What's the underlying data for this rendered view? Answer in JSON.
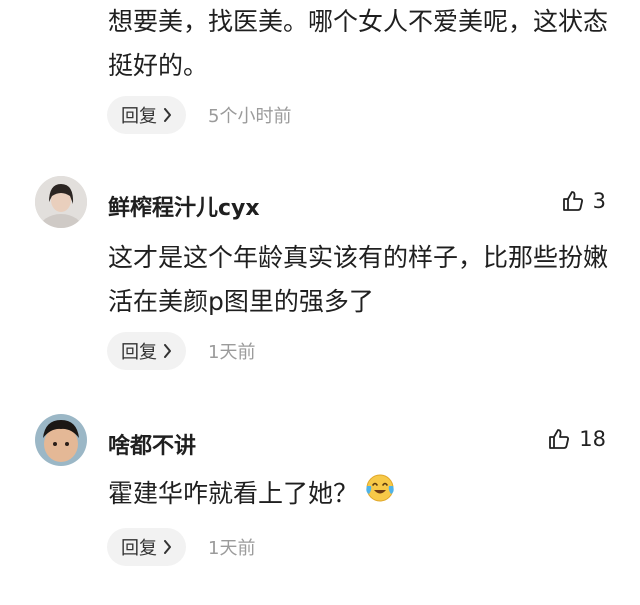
{
  "comments": [
    {
      "text": "想要美，找医美。哪个女人不爱美呢，这状态挺好的。",
      "reply_label": "回复",
      "time": "5个小时前"
    },
    {
      "username": "鲜榨程汁儿cyx",
      "likes": "3",
      "text": "这才是这个年龄真实该有的样子，比那些扮嫩活在美颜p图里的强多了",
      "reply_label": "回复",
      "time": "1天前"
    },
    {
      "username": "啥都不讲",
      "likes": "18",
      "text": "霍建华咋就看上了她？",
      "emoji": "crying-laughing-emoji",
      "reply_label": "回复",
      "time": "1天前"
    }
  ]
}
